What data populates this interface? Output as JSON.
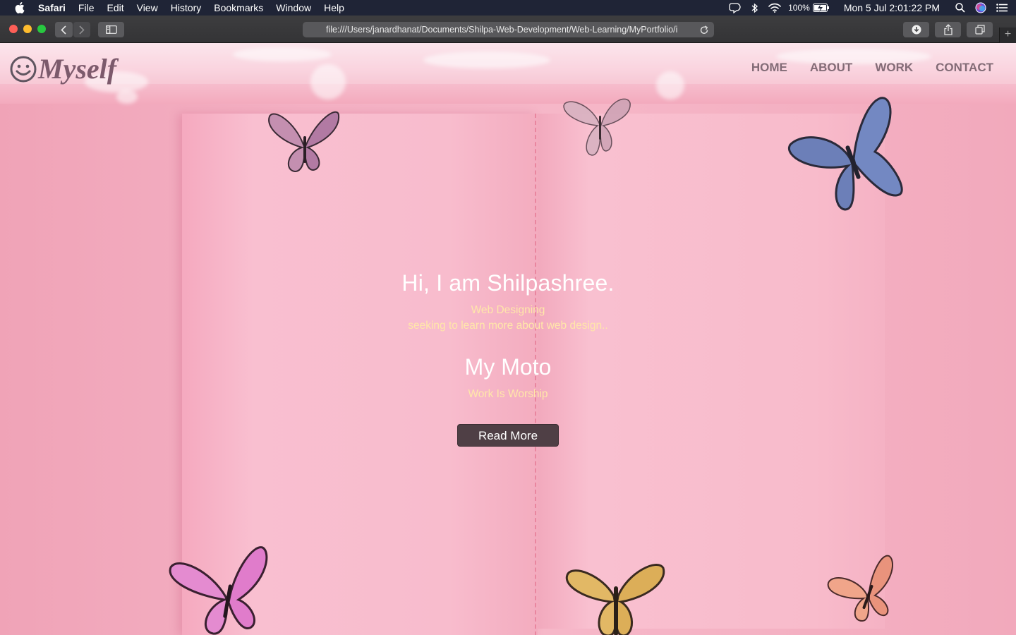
{
  "menubar": {
    "app_name": "Safari",
    "menus": [
      "File",
      "Edit",
      "View",
      "History",
      "Bookmarks",
      "Window",
      "Help"
    ],
    "battery": "100%",
    "clock": "Mon 5 Jul  2:01:22 PM"
  },
  "browser": {
    "url": "file:///Users/janardhanat/Documents/Shilpa-Web-Development/Web-Learning/MyPortfolio/i"
  },
  "site": {
    "logo_text": "Myself",
    "nav": [
      "HOME",
      "ABOUT",
      "WORK",
      "CONTACT"
    ],
    "hero": {
      "greeting": "Hi, I am Shilpashree.",
      "role": "Web Designing",
      "tagline": "seeking to learn more about web design..",
      "moto_heading": "My Moto",
      "moto": "Work Is Worship",
      "cta": "Read More"
    }
  },
  "colors": {
    "page_pink": "#f4b1c4",
    "nav_text": "#826b76",
    "accent_yellow": "#ffe7a9",
    "button_bg": "#4f3f45"
  }
}
